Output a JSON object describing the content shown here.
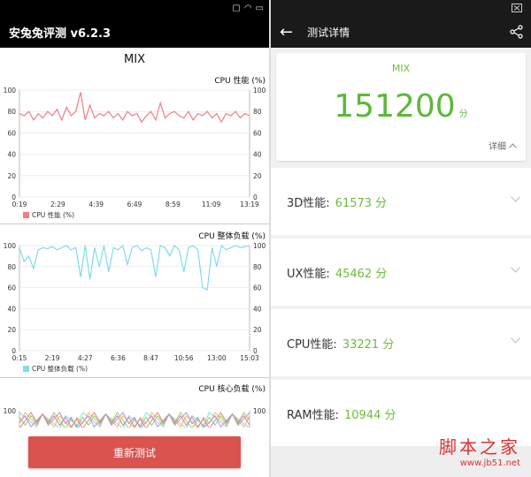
{
  "left": {
    "app_title": "安兔兔评测 v6.2.3",
    "device": "MIX",
    "retest_label": "重新测试"
  },
  "right": {
    "title": "测试详情",
    "score_label": "MIX",
    "total_score": "151200",
    "score_unit": "分",
    "detail_link": "详细",
    "rows": [
      {
        "label": "3D性能:",
        "value": "61573",
        "unit": "分"
      },
      {
        "label": "UX性能:",
        "value": "45462",
        "unit": "分"
      },
      {
        "label": "CPU性能:",
        "value": "33221",
        "unit": "分"
      },
      {
        "label": "RAM性能:",
        "value": "10944",
        "unit": "分"
      }
    ]
  },
  "watermark": {
    "line1": "脚本之家",
    "line2": "www.jb51.net"
  },
  "colors": {
    "accent_green": "#6cbd3a",
    "cpu_perf": "#f08080",
    "cpu_load": "#7fdcef",
    "retest_button": "#d9534f"
  },
  "chart_data": [
    {
      "type": "line",
      "title": "CPU 性能 (%)",
      "legend": "CPU 性能 (%)",
      "x_ticks": [
        "0:19",
        "2:29",
        "4:39",
        "6:49",
        "8:59",
        "11:09",
        "13:19"
      ],
      "y_ticks": [
        0,
        20,
        40,
        60,
        80,
        100
      ],
      "ylim": [
        0,
        100
      ],
      "series": [
        {
          "values": [
            78,
            76,
            80,
            72,
            78,
            74,
            80,
            76,
            82,
            72,
            84,
            76,
            80,
            98,
            72,
            86,
            74,
            78,
            76,
            80,
            74,
            78,
            72,
            80,
            76,
            78,
            70,
            76,
            80,
            72,
            88,
            74,
            78,
            80,
            76,
            74,
            80,
            72,
            78,
            76,
            80,
            74,
            78,
            70,
            78,
            76,
            80,
            74,
            78,
            76
          ]
        }
      ]
    },
    {
      "type": "line",
      "title": "CPU 整体负载 (%)",
      "legend": "CPU 整体负载 (%)",
      "x_ticks": [
        "0:15",
        "2:19",
        "4:27",
        "6:36",
        "8:47",
        "10:56",
        "13:00",
        "15:03"
      ],
      "y_ticks": [
        0,
        20,
        40,
        60,
        80,
        100
      ],
      "ylim": [
        0,
        100
      ],
      "series": [
        {
          "values": [
            98,
            85,
            90,
            78,
            96,
            98,
            97,
            99,
            96,
            98,
            100,
            96,
            98,
            70,
            100,
            68,
            98,
            80,
            100,
            75,
            98,
            96,
            100,
            82,
            98,
            100,
            95,
            98,
            96,
            70,
            100,
            98,
            90,
            100,
            96,
            75,
            98,
            100,
            96,
            60,
            58,
            98,
            80,
            100,
            96,
            98,
            100,
            98,
            99,
            100
          ]
        }
      ]
    },
    {
      "type": "line",
      "title": "CPU 核心负载 (%)",
      "y_ticks": [
        100
      ],
      "ylim": [
        0,
        100
      ]
    }
  ]
}
